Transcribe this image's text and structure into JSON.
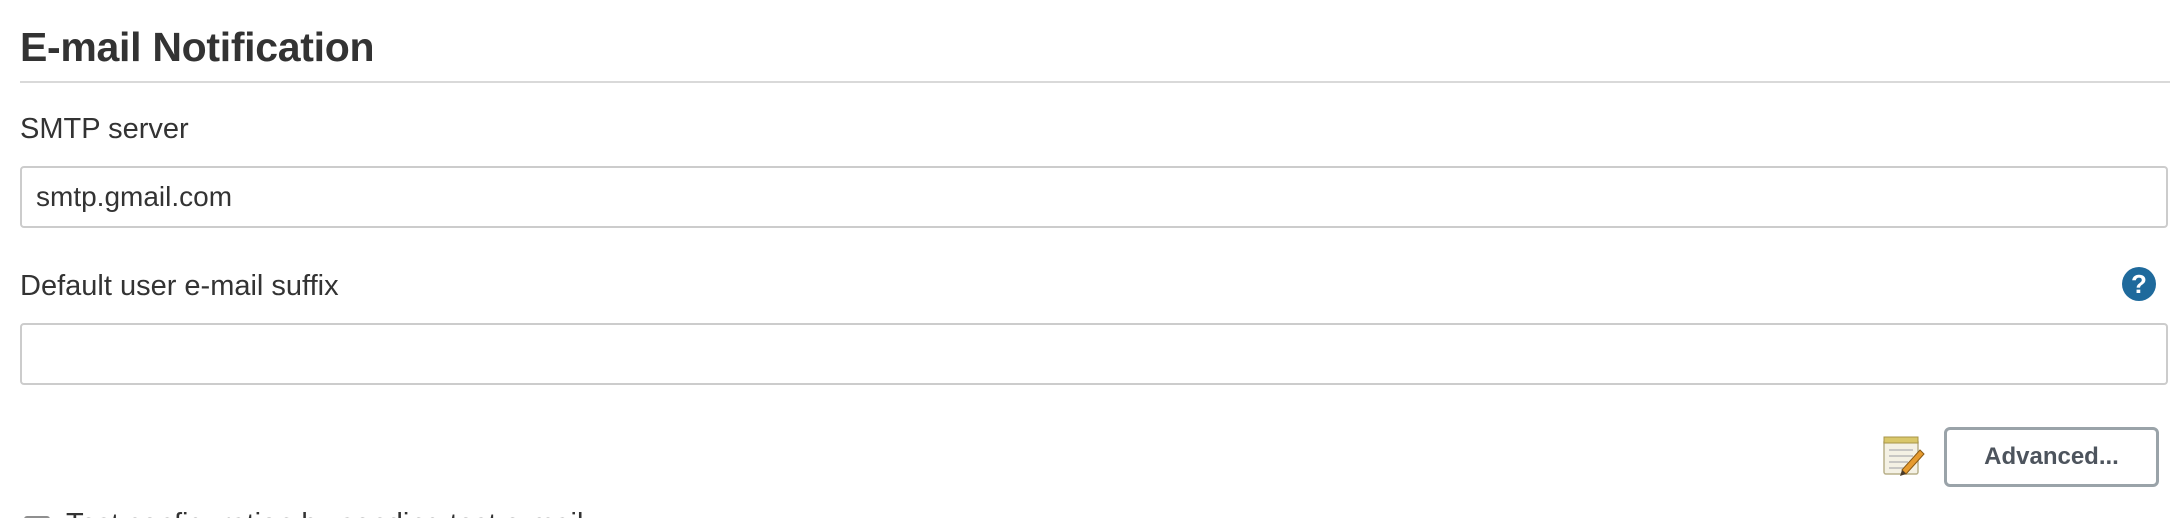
{
  "section": {
    "title": "E-mail Notification"
  },
  "smtp": {
    "label": "SMTP server",
    "value": "smtp.gmail.com"
  },
  "suffix": {
    "label": "Default user e-mail suffix",
    "value": "",
    "help_icon": "help-circle-icon",
    "help_glyph": "?"
  },
  "actions": {
    "notepad_icon": "notepad-edit-icon",
    "advanced_label": "Advanced..."
  },
  "test": {
    "label": "Test configuration by sending test e-mail",
    "checked": false
  },
  "colors": {
    "help_icon": "#1f6a9c",
    "divider": "#d9d9d9",
    "button_border": "#9aa3a9",
    "text": "#333333"
  }
}
